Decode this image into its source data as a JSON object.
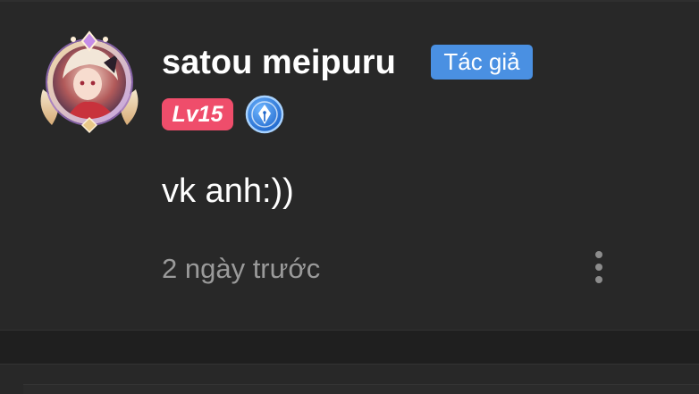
{
  "comment": {
    "username": "satou meipuru",
    "author_badge": "Tác giả",
    "level_badge": "Lv15",
    "text": "vk anh:))",
    "timestamp": "2 ngày trước"
  },
  "icons": {
    "avatar": "avatar-frame-icon",
    "pen_badge": "pen-nib-icon",
    "more": "more-vertical-icon"
  },
  "colors": {
    "background": "#282828",
    "author_badge": "#4a90e2",
    "level_badge": "#ef4d6b",
    "username": "#ffffff",
    "timestamp": "#9a9a9a"
  }
}
